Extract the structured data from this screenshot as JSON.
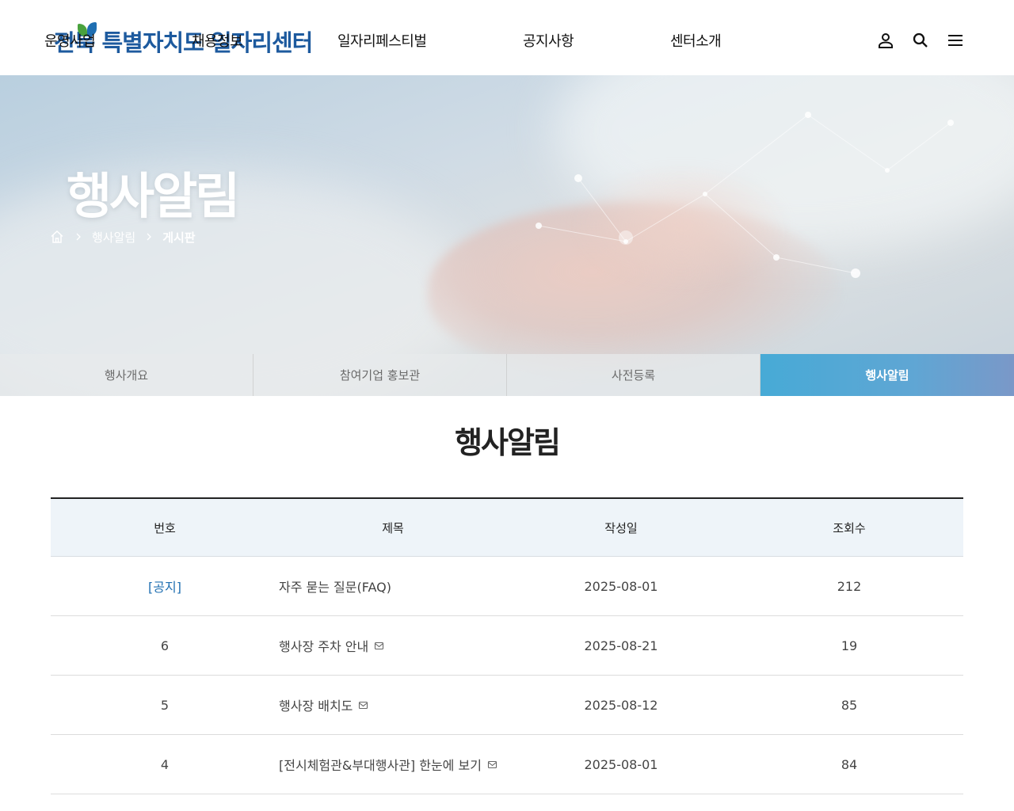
{
  "header": {
    "logo_text": "전북 특별자치도 일자리센터",
    "nav": [
      "운영사업",
      "채용정보",
      "일자리페스티벌",
      "공지사항",
      "센터소개"
    ],
    "utility_icons": [
      "user-icon",
      "search-icon",
      "menu-icon"
    ]
  },
  "hero": {
    "title": "행사알림",
    "breadcrumb": [
      "행사알림",
      "게시판"
    ]
  },
  "tabs": [
    {
      "label": "행사개요",
      "active": false
    },
    {
      "label": "참여기업 홍보관",
      "active": false
    },
    {
      "label": "사전등록",
      "active": false
    },
    {
      "label": "행사알림",
      "active": true
    }
  ],
  "page": {
    "title": "행사알림"
  },
  "board": {
    "columns": [
      "번호",
      "제목",
      "작성일",
      "조회수"
    ],
    "rows": [
      {
        "no": "[공지]",
        "title": "자주 묻는 질문(FAQ)",
        "date": "2025-08-01",
        "views": "212",
        "notice": true,
        "attachment": false
      },
      {
        "no": "6",
        "title": "행사장 주차 안내",
        "date": "2025-08-21",
        "views": "19",
        "notice": false,
        "attachment": true
      },
      {
        "no": "5",
        "title": "행사장 배치도",
        "date": "2025-08-12",
        "views": "85",
        "notice": false,
        "attachment": true
      },
      {
        "no": "4",
        "title": "[전시체험관&부대행사관] 한눈에 보기",
        "date": "2025-08-01",
        "views": "84",
        "notice": false,
        "attachment": true
      }
    ]
  },
  "colors": {
    "logo_blue": "#1d5a9e",
    "notice_blue": "#1f6fb2",
    "active_tab": "#47aad6",
    "table_head_bg": "#eef4f9"
  }
}
